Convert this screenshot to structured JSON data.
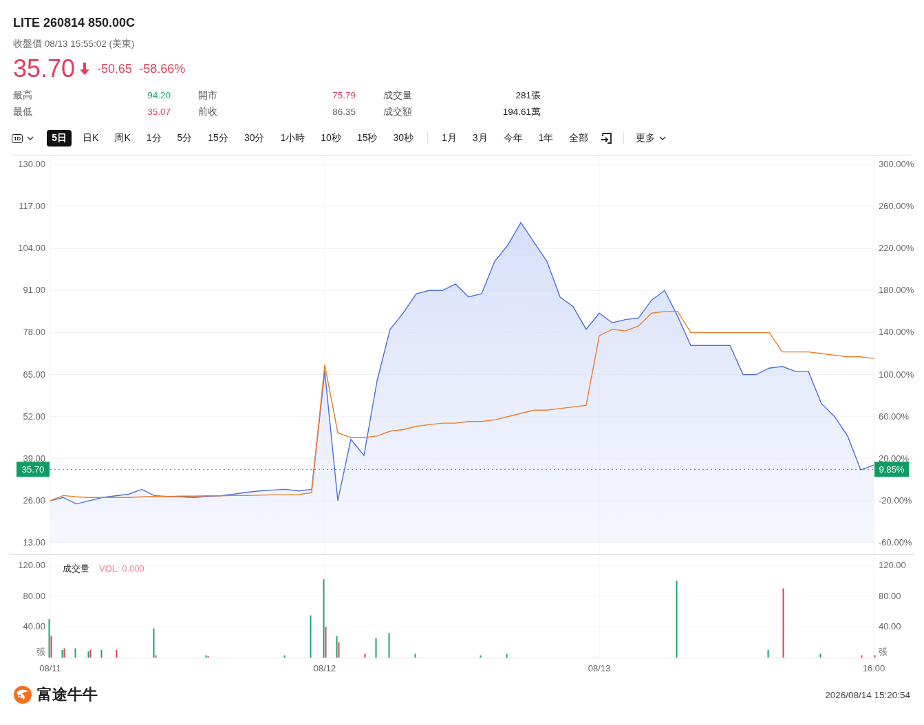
{
  "header": {
    "title": "LITE 260814 850.00C",
    "subtitle": "收盤價 08/13 15:55:02 (美東)",
    "price": "35.70",
    "falling": true,
    "change": "-50.65",
    "change_pct": "-58.66%"
  },
  "stats": [
    {
      "label": "最高",
      "value": "94.20",
      "color": "#1aa56a"
    },
    {
      "label": "開市",
      "value": "75.79",
      "color": "#e0405a"
    },
    {
      "label": "成交量",
      "value": "281張",
      "color": "#222222"
    },
    {
      "label": "最低",
      "value": "35.07",
      "color": "#e0405a"
    },
    {
      "label": "前收",
      "value": "86.35",
      "color": "#666666"
    },
    {
      "label": "成交額",
      "value": "194.61萬",
      "color": "#222222"
    }
  ],
  "toolbar": {
    "interval_label": "1D",
    "intraday_tabs": [
      {
        "label": "5日",
        "selected": true
      },
      {
        "label": "日K",
        "selected": false
      },
      {
        "label": "周K",
        "selected": false
      },
      {
        "label": "1分",
        "selected": false
      },
      {
        "label": "5分",
        "selected": false
      },
      {
        "label": "15分",
        "selected": false
      },
      {
        "label": "30分",
        "selected": false
      },
      {
        "label": "1小時",
        "selected": false
      },
      {
        "label": "10秒",
        "selected": false
      },
      {
        "label": "15秒",
        "selected": false
      },
      {
        "label": "30秒",
        "selected": false
      }
    ],
    "range_tabs": [
      {
        "label": "1月",
        "selected": false
      },
      {
        "label": "3月",
        "selected": false
      },
      {
        "label": "今年",
        "selected": false
      },
      {
        "label": "1年",
        "selected": false
      },
      {
        "label": "全部",
        "selected": false
      }
    ],
    "more_label": "更多"
  },
  "price_chart": {
    "current_change_tag": "9.85%",
    "right_axis_labels": [
      "300.00%",
      "260.00%",
      "220.00%",
      "180.00%",
      "140.00%",
      "100.00%",
      "60.00%",
      "20.00%",
      "-20.00%",
      "-60.00%"
    ],
    "chart_data": {
      "type": "line",
      "grid": true,
      "ref_lines": [
        {
          "axis": "y",
          "value": 35.7,
          "label": "35.70",
          "color": "#1aa56a"
        }
      ],
      "ylim": [
        13,
        130
      ],
      "yticks": [
        {
          "value": 130,
          "label": "130.00"
        },
        {
          "value": 117,
          "label": "117.00"
        },
        {
          "value": 104,
          "label": "104.00"
        },
        {
          "value": 91,
          "label": "91.00"
        },
        {
          "value": 78,
          "label": "78.00"
        },
        {
          "value": 65,
          "label": "65.00"
        },
        {
          "value": 52,
          "label": "52.00"
        },
        {
          "value": 39,
          "label": "39.00"
        },
        {
          "value": 26,
          "label": "26.00"
        },
        {
          "value": 13,
          "label": "13.00"
        }
      ],
      "categories": [
        null,
        null,
        null,
        null,
        null,
        null,
        null,
        null,
        null,
        null,
        null,
        null,
        null,
        null,
        null,
        null,
        null,
        null,
        null,
        null,
        null,
        null,
        null,
        null,
        null,
        null,
        null,
        null,
        null,
        null,
        null,
        null,
        null,
        null,
        null,
        null,
        null,
        null,
        null,
        null,
        null,
        null,
        null,
        null,
        null,
        null,
        null,
        null,
        null,
        null,
        null,
        null,
        null,
        null,
        null,
        null,
        null,
        null,
        null,
        null,
        null,
        null,
        null,
        null
      ],
      "series": [
        {
          "type": "area",
          "color": "#4a6fdc",
          "values": [
            26,
            27,
            25,
            26,
            27,
            27.5,
            28,
            29.5,
            27.5,
            27.3,
            27.2,
            27,
            27.3,
            27.5,
            28,
            28.6,
            29,
            29.3,
            29.5,
            29,
            29.5,
            66,
            26,
            45,
            40,
            63,
            79,
            84,
            90,
            91,
            91,
            93,
            89,
            90,
            100,
            105,
            112,
            106,
            100,
            89,
            86,
            79,
            84,
            81,
            82,
            82.5,
            88,
            91,
            83,
            74,
            74,
            74,
            74,
            65,
            65,
            67,
            67.5,
            66,
            66,
            56,
            52,
            46,
            35.5,
            37
          ]
        },
        {
          "color": "#f07a26",
          "values": [
            26,
            27.6,
            27.2,
            27,
            27,
            27,
            27,
            27.2,
            27.3,
            27.3,
            27.4,
            27.4,
            27.5,
            27.5,
            27.6,
            27.6,
            27.7,
            27.8,
            27.8,
            27.9,
            28.5,
            68,
            47,
            45.5,
            45.5,
            46,
            47.5,
            48,
            49,
            49.5,
            50,
            50,
            50.5,
            50.5,
            51,
            52,
            53,
            54,
            54,
            54.5,
            55,
            55.5,
            77,
            79,
            78.5,
            80,
            84,
            84.5,
            84.5,
            78,
            78,
            78,
            78,
            78,
            78,
            78,
            72,
            72,
            72,
            71.5,
            71,
            70.5,
            70.5,
            70
          ]
        }
      ]
    }
  },
  "volume_chart": {
    "title": "成交量",
    "reading": "VOL: 0.000",
    "unit_left": "張",
    "unit_right": "張",
    "right_axis_labels": [
      "120.00",
      "80.00",
      "40.00"
    ],
    "chart_data": {
      "type": "bar",
      "grid": true,
      "ylim": [
        0,
        120
      ],
      "yticks": [
        {
          "value": 120,
          "label": "120.00"
        },
        {
          "value": 80,
          "label": "80.00"
        },
        {
          "value": 40,
          "label": "40.00"
        }
      ],
      "categories": [
        "08/11",
        null,
        null,
        null,
        null,
        null,
        null,
        null,
        null,
        null,
        null,
        null,
        null,
        null,
        null,
        null,
        null,
        null,
        null,
        null,
        null,
        "08/12",
        null,
        null,
        null,
        null,
        null,
        null,
        null,
        null,
        null,
        null,
        null,
        null,
        null,
        null,
        null,
        null,
        null,
        null,
        null,
        null,
        "08/13",
        null,
        null,
        null,
        null,
        null,
        null,
        null,
        null,
        null,
        null,
        null,
        null,
        null,
        null,
        null,
        null,
        null,
        null,
        null,
        null,
        "16:00"
      ],
      "series": [
        {
          "color": "#1aa56a",
          "values": [
            50,
            10,
            12,
            8,
            10,
            null,
            null,
            null,
            38,
            null,
            null,
            null,
            3,
            null,
            null,
            null,
            null,
            null,
            3,
            null,
            55,
            102,
            28,
            null,
            null,
            25,
            32,
            null,
            5,
            null,
            null,
            null,
            null,
            3,
            null,
            5,
            null,
            null,
            null,
            null,
            null,
            null,
            null,
            null,
            null,
            null,
            null,
            null,
            100,
            null,
            null,
            null,
            null,
            null,
            null,
            10,
            null,
            null,
            null,
            5,
            null,
            null,
            null,
            null
          ]
        },
        {
          "color": "#e0405a",
          "values": [
            28,
            12,
            null,
            10,
            null,
            10,
            null,
            null,
            3,
            null,
            null,
            null,
            2,
            null,
            null,
            null,
            null,
            null,
            null,
            null,
            null,
            40,
            20,
            null,
            5,
            null,
            null,
            null,
            null,
            null,
            null,
            null,
            null,
            null,
            null,
            null,
            null,
            null,
            null,
            null,
            null,
            null,
            null,
            null,
            null,
            null,
            null,
            null,
            null,
            null,
            null,
            null,
            null,
            null,
            null,
            null,
            90,
            null,
            null,
            null,
            null,
            null,
            3,
            3
          ]
        }
      ]
    }
  },
  "footer": {
    "brand": "富途牛牛",
    "timestamp": "2026/08/14 15:20:54"
  }
}
